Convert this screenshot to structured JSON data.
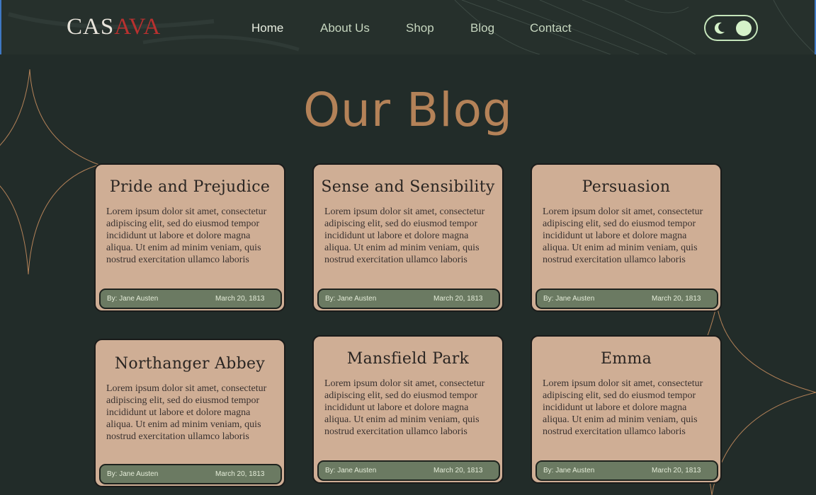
{
  "header": {
    "logo_main": "CAS",
    "logo_accent": "AVA",
    "nav": [
      {
        "label": "Home"
      },
      {
        "label": "About Us"
      },
      {
        "label": "Shop"
      },
      {
        "label": "Blog"
      },
      {
        "label": "Contact"
      }
    ],
    "active_nav": "Home",
    "theme_toggle": {
      "mode": "light",
      "icon": "moon-icon"
    }
  },
  "main": {
    "title": "Our Blog",
    "posts": [
      {
        "title": "Pride and Prejudice",
        "excerpt": "Lorem ipsum dolor sit amet, consectetur adipiscing elit, sed do eiusmod tempor incididunt ut labore et dolore magna aliqua. Ut enim ad minim veniam, quis nostrud exercitation ullamco laboris",
        "author": "By: Jane Austen",
        "date": "March 20, 1813"
      },
      {
        "title": "Sense and Sensibility",
        "excerpt": "Lorem ipsum dolor sit amet, consectetur adipiscing elit, sed do eiusmod tempor incididunt ut labore et dolore magna aliqua. Ut enim ad minim veniam, quis nostrud exercitation ullamco laboris",
        "author": "By: Jane Austen",
        "date": "March 20, 1813"
      },
      {
        "title": "Persuasion",
        "excerpt": "Lorem ipsum dolor sit amet, consectetur adipiscing elit, sed do eiusmod tempor incididunt ut labore et dolore magna aliqua. Ut enim ad minim veniam, quis nostrud exercitation ullamco laboris",
        "author": "By: Jane Austen",
        "date": "March 20, 1813"
      },
      {
        "title": "Northanger Abbey",
        "excerpt": "Lorem ipsum dolor sit amet, consectetur adipiscing elit, sed do eiusmod tempor incididunt ut labore et dolore magna aliqua. Ut enim ad minim veniam, quis nostrud exercitation ullamco laboris",
        "author": "By: Jane Austen",
        "date": "March 20, 1813"
      },
      {
        "title": "Mansfield Park",
        "excerpt": "Lorem ipsum dolor sit amet, consectetur adipiscing elit, sed do eiusmod tempor incididunt ut labore et dolore magna aliqua. Ut enim ad minim veniam, quis nostrud exercitation ullamco laboris",
        "author": "By: Jane Austen",
        "date": "March 20, 1813"
      },
      {
        "title": "Emma",
        "excerpt": "Lorem ipsum dolor sit amet, consectetur adipiscing elit, sed do eiusmod tempor incididunt ut labore et dolore magna aliqua. Ut enim ad minim veniam, quis nostrud exercitation ullamco laboris",
        "author": "By: Jane Austen",
        "date": "March 20, 1813"
      }
    ]
  },
  "colors": {
    "background": "#222c29",
    "header": "#26302c",
    "title": "#b48258",
    "card": "#cfae95",
    "card_footer": "#6b7a62",
    "nav_text": "#c6d6bf",
    "toggle": "#c5e5bb",
    "logo_accent": "#b8312f",
    "decoration_line": "#b48258"
  }
}
